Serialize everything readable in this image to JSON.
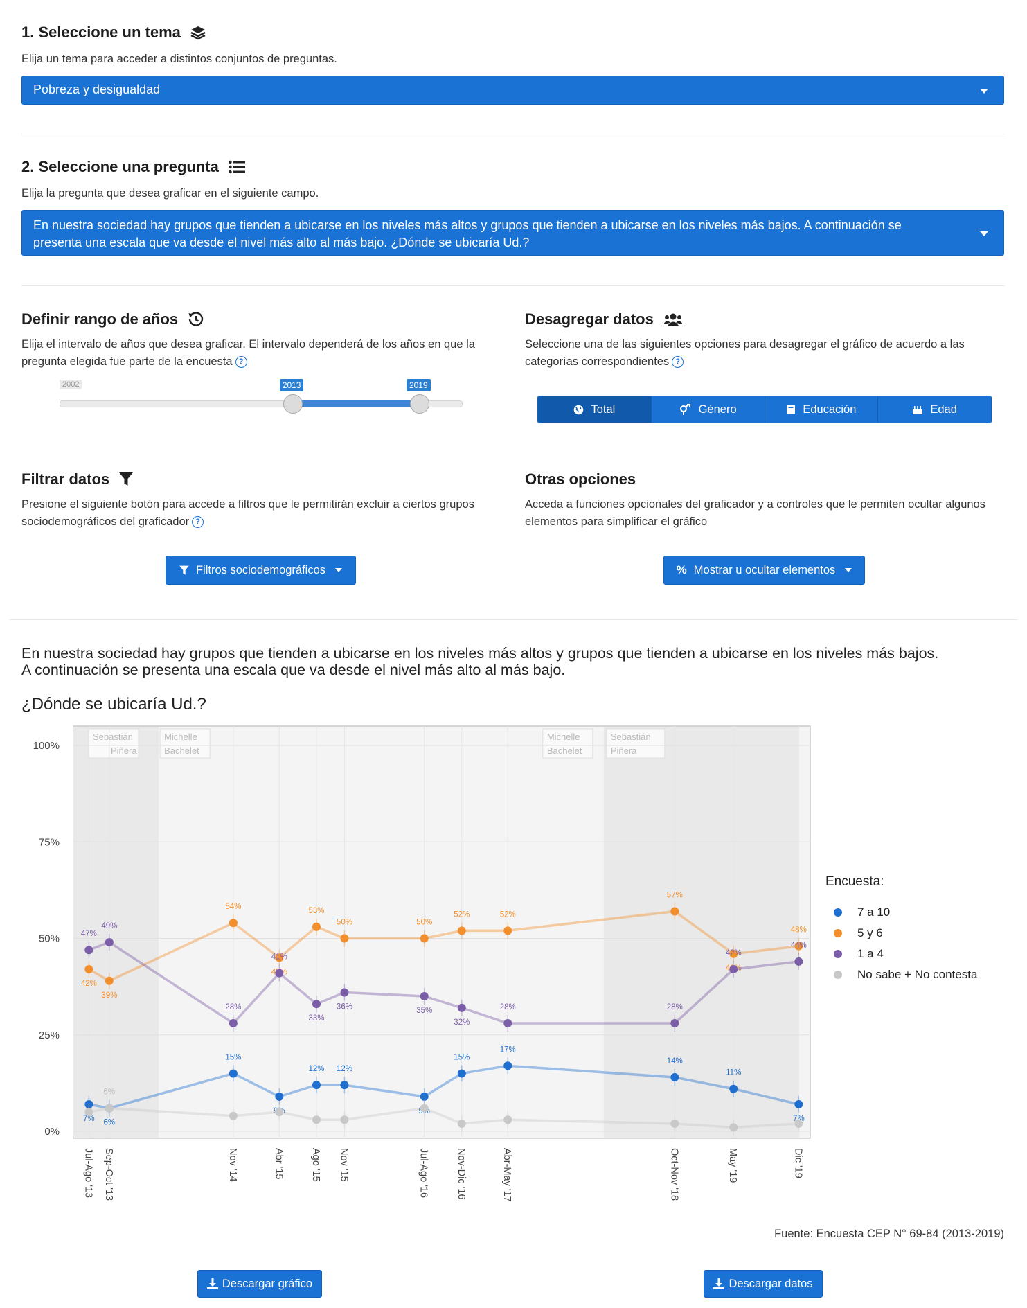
{
  "topic": {
    "title": "1. Seleccione un tema",
    "description": "Elija un tema para acceder a distintos conjuntos de preguntas.",
    "selected": "Pobreza y desigualdad"
  },
  "question": {
    "title": "2. Seleccione una pregunta",
    "description": "Elija la pregunta que desea graficar en el siguiente campo.",
    "selected_line1": "En nuestra sociedad hay grupos que tienden a ubicarse en los niveles más altos y grupos que tienden a ubicarse en los niveles más bajos. A continuación se",
    "selected_line2": "presenta una escala que va desde el nivel más alto al más bajo. ¿Dónde se ubicaría Ud.?"
  },
  "years": {
    "title": "Definir rango de años",
    "description": "Elija el intervalo de años que desea graficar. El intervalo dependerá de los años en que la pregunta elegida fue parte de la encuesta",
    "min_label": "2002",
    "from_label": "2013",
    "to_label": "2019",
    "slider_min": 2002,
    "slider_max": 2021,
    "from": 2013,
    "to": 2019
  },
  "disaggregate": {
    "title": "Desagregar datos",
    "description": "Seleccione una de las siguientes opciones para desagregar el gráfico de acuerdo a las categorías correspondientes",
    "options": [
      "Total",
      "Género",
      "Educación",
      "Edad"
    ],
    "active": "Total"
  },
  "filter": {
    "title": "Filtrar datos",
    "description": "Presione el siguiente botón para accede a filtros que le permitirán excluir a ciertos grupos sociodemográficos del graficador",
    "button": "Filtros sociodemográficos"
  },
  "other": {
    "title": "Otras opciones",
    "description": "Acceda a funciones opcionales del graficador y a controles que le permiten ocultar algunos elementos para simplificar el gráfico",
    "button": "Mostrar u ocultar elementos"
  },
  "chart_heading": {
    "line1": "En nuestra sociedad hay grupos que tienden a ubicarse en los niveles más altos y grupos que tienden a ubicarse en los niveles más bajos.",
    "line2": "A continuación se presenta una escala que va desde el nivel más alto al más bajo.",
    "line3": "¿Dónde se ubicaría Ud.?"
  },
  "source": "Fuente: Encuesta CEP N° 69-84 (2013-2019)",
  "buttons": {
    "download_chart": "Descargar gráfico",
    "download_data": "Descargar datos"
  },
  "colors": {
    "accent": "#1a73d4",
    "s_7a10": "#1f6fd1",
    "s_5y6": "#f28e2c",
    "s_1a4": "#7b5ea7",
    "s_ns": "#c8c8c8"
  },
  "chart_data": {
    "type": "line",
    "title": "",
    "ylabel": "",
    "xlabel": "",
    "ylim": [
      0,
      100
    ],
    "yticks": [
      "0%",
      "25%",
      "50%",
      "75%",
      "100%"
    ],
    "legend_title": "Encuesta:",
    "legend_position": "right",
    "periods": [
      {
        "name": "Sebastián Piñera",
        "color": "#e9e9e9",
        "from": "2010-03",
        "to": "2014-03"
      },
      {
        "name": "Michelle Bachelet",
        "color": "#f4f4f4",
        "from": "2014-03",
        "to": "2018-03"
      },
      {
        "name": "Sebastián Piñera",
        "color": "#e9e9e9",
        "from": "2018-03",
        "to": "2019-12"
      }
    ],
    "period_labels": [
      {
        "line1": "Sebastián",
        "line2": "Piñera"
      },
      {
        "line1": "Michelle",
        "line2": "Bachelet"
      },
      {
        "line1": "Michelle",
        "line2": "Bachelet"
      },
      {
        "line1": "Sebastián",
        "line2": "Piñera"
      }
    ],
    "categories": [
      "Jul-Ago '13",
      "Sep-Oct '13",
      "Nov '14",
      "Abr '15",
      "Ago '15",
      "Nov '15",
      "Jul-Ago '16",
      "Nov-Dic '16",
      "Abr-May '17",
      "Oct-Nov '18",
      "May '19",
      "Dic '19"
    ],
    "x": [
      "2013-07-15",
      "2013-09-20",
      "2014-11-01",
      "2015-04-01",
      "2015-08-01",
      "2015-11-01",
      "2016-07-20",
      "2016-11-20",
      "2017-04-20",
      "2018-10-20",
      "2019-05-01",
      "2019-12-01"
    ],
    "series": [
      {
        "name": "7 a 10",
        "values": [
          7,
          6,
          15,
          9,
          12,
          12,
          9,
          15,
          17,
          14,
          11,
          7
        ],
        "labels": [
          "7%",
          "6%",
          "15%",
          "9%",
          "12%",
          "12%",
          "9%",
          "15%",
          "17%",
          "14%",
          "11%",
          "7%"
        ]
      },
      {
        "name": "5 y 6",
        "values": [
          42,
          39,
          54,
          45,
          53,
          50,
          50,
          52,
          52,
          57,
          46,
          48
        ],
        "labels": [
          "42%",
          "39%",
          "54%",
          "45%",
          "53%",
          "50%",
          "50%",
          "52%",
          "52%",
          "57%",
          "46%",
          "48%"
        ]
      },
      {
        "name": "1 a 4",
        "values": [
          47,
          49,
          28,
          41,
          33,
          36,
          35,
          32,
          28,
          28,
          42,
          44
        ],
        "labels": [
          "47%",
          "49%",
          "28%",
          "41%",
          "33%",
          "36%",
          "35%",
          "32%",
          "28%",
          "28%",
          "42%",
          "44%"
        ]
      },
      {
        "name": "No sabe + No contesta",
        "values": [
          5,
          6,
          4,
          5,
          3,
          3,
          6,
          2,
          3,
          2,
          1,
          2
        ],
        "labels": [
          "",
          "6%",
          "",
          "",
          "",
          "",
          "",
          "",
          "",
          "",
          "",
          ""
        ]
      }
    ]
  }
}
